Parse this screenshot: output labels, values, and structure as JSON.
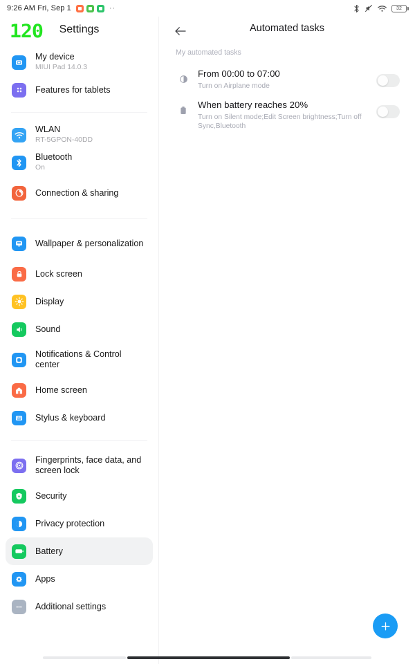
{
  "status_bar": {
    "time": "9:26 AM Fri, Sep 1",
    "app_icons": [
      {
        "name": "app-icon-orange",
        "color": "#ff7043"
      },
      {
        "name": "app-icon-green",
        "color": "#4cc24c"
      },
      {
        "name": "app-icon-green-2",
        "color": "#2bc46a"
      }
    ],
    "overflow_dots": "··",
    "icons": [
      "bluetooth-icon",
      "mute-icon",
      "wifi-icon",
      "battery-icon"
    ],
    "battery_level": "32"
  },
  "sidebar": {
    "refresh_rate_badge": "120",
    "title": "Settings",
    "groups": [
      {
        "items": [
          {
            "label": "My device",
            "sub": "MIUI Pad 14.0.3",
            "icon": "device-icon",
            "color": "#2196f3",
            "selected": false
          },
          {
            "label": "Features for tablets",
            "sub": "",
            "icon": "grid-icon",
            "color": "#7c6ff0",
            "selected": false
          }
        ]
      },
      {
        "items": [
          {
            "label": "WLAN",
            "sub": "RT-5GPON-40DD",
            "icon": "wifi-icon",
            "color": "#33a3f4",
            "selected": false
          },
          {
            "label": "Bluetooth",
            "sub": "On",
            "icon": "bluetooth-icon",
            "color": "#2196f3",
            "selected": false
          },
          {
            "label": "Connection & sharing",
            "sub": "",
            "icon": "connection-icon",
            "color": "#f2643c",
            "selected": false
          }
        ]
      },
      {
        "items": [
          {
            "label": "Wallpaper & personalization",
            "sub": "",
            "icon": "wallpaper-icon",
            "color": "#2196f3",
            "selected": false
          },
          {
            "label": "Lock screen",
            "sub": "",
            "icon": "lock-icon",
            "color": "#fa6b46",
            "selected": false
          },
          {
            "label": "Display",
            "sub": "",
            "icon": "brightness-icon",
            "color": "#ffc224",
            "selected": false
          },
          {
            "label": "Sound",
            "sub": "",
            "icon": "sound-icon",
            "color": "#15c95f",
            "selected": false
          },
          {
            "label": "Notifications & Control center",
            "sub": "",
            "icon": "notification-icon",
            "color": "#2196f3",
            "selected": false
          },
          {
            "label": "Home screen",
            "sub": "",
            "icon": "home-icon",
            "color": "#fa6b46",
            "selected": false
          },
          {
            "label": "Stylus & keyboard",
            "sub": "",
            "icon": "keyboard-icon",
            "color": "#2196f3",
            "selected": false
          }
        ]
      },
      {
        "items": [
          {
            "label": "Fingerprints, face data, and screen lock",
            "sub": "",
            "icon": "fingerprint-icon",
            "color": "#7c6ff0",
            "selected": false
          },
          {
            "label": "Security",
            "sub": "",
            "icon": "shield-icon",
            "color": "#15c95f",
            "selected": false
          },
          {
            "label": "Privacy protection",
            "sub": "",
            "icon": "privacy-icon",
            "color": "#2196f3",
            "selected": false
          },
          {
            "label": "Battery",
            "sub": "",
            "icon": "battery-icon",
            "color": "#15c95f",
            "selected": true
          },
          {
            "label": "Apps",
            "sub": "",
            "icon": "apps-icon",
            "color": "#2196f3",
            "selected": false
          },
          {
            "label": "Additional settings",
            "sub": "",
            "icon": "more-icon",
            "color": "#aab4c2",
            "selected": false
          }
        ]
      }
    ]
  },
  "main": {
    "back_label": "Back",
    "title": "Automated tasks",
    "section_label": "My automated tasks",
    "tasks": [
      {
        "title": "From 00:00 to 07:00",
        "desc": "Turn on Airplane mode",
        "icon": "moon-contrast-icon",
        "enabled": false
      },
      {
        "title": "When battery reaches 20%",
        "desc": "Turn on Silent mode;Edit Screen brightness;Turn off Sync,Bluetooth",
        "icon": "battery-icon",
        "enabled": false
      }
    ],
    "fab_label": "+"
  }
}
